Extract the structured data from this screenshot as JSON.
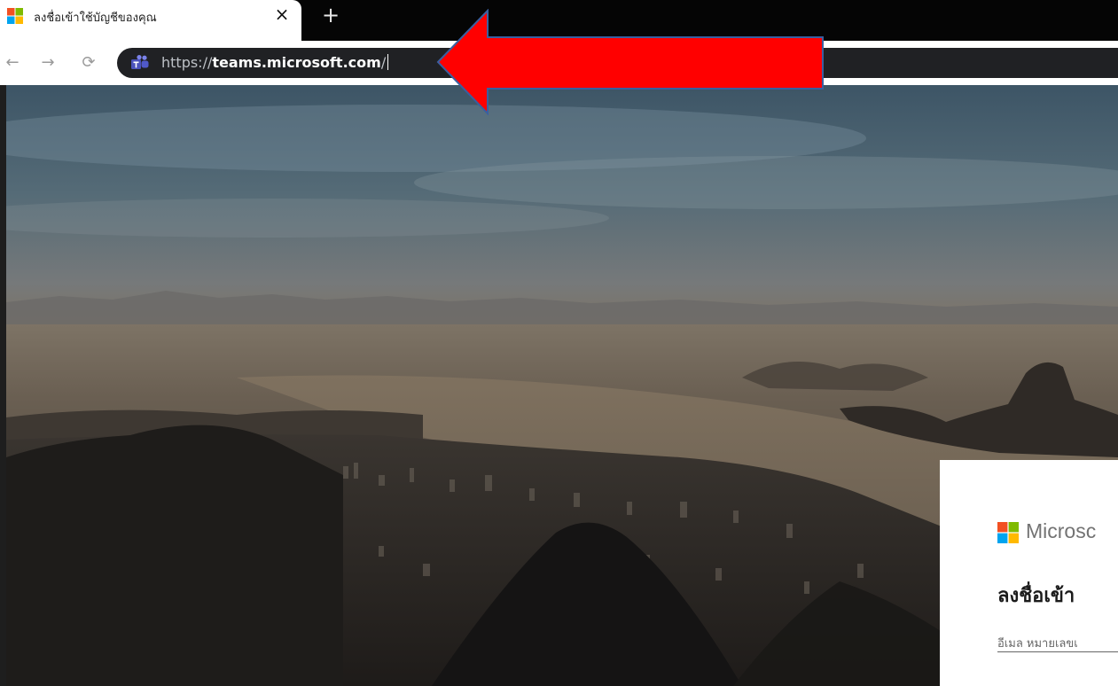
{
  "browser": {
    "tab": {
      "title": "ลงชื่อเข้าใช้บัญชีของคุณ",
      "close_glyph": "×"
    },
    "new_tab_glyph": "+",
    "nav": {
      "back_glyph": "←",
      "forward_glyph": "→",
      "reload_glyph": "⟳"
    },
    "address_bar": {
      "scheme": "https://",
      "host": "teams.microsoft.com",
      "path": "/"
    }
  },
  "signin": {
    "brand": "Microsc",
    "title": "ลงชื่อเข้า",
    "email_placeholder": "อีเมล หมายเลขเ"
  },
  "colors": {
    "annotation_arrow": "#ff0000",
    "annotation_arrow_outline": "#3a5fa0",
    "ms_red": "#f25022",
    "ms_green": "#7fba00",
    "ms_blue": "#00a4ef",
    "ms_yellow": "#ffb900"
  },
  "icons": {
    "tab_favicon": "microsoft-logo-icon",
    "site_icon": "teams-icon",
    "annotation": "red-arrow-left-icon"
  }
}
